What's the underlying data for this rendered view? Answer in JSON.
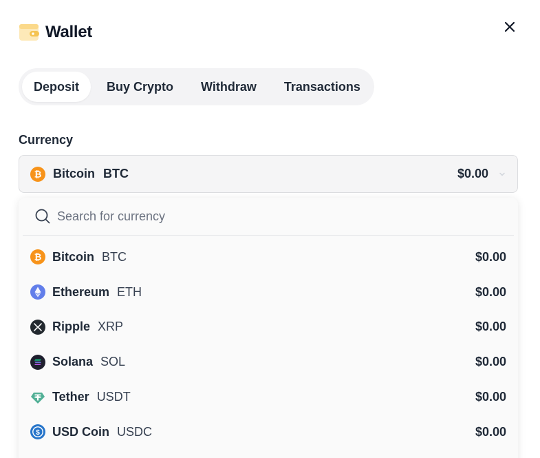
{
  "header": {
    "title": "Wallet",
    "icon": "wallet-icon",
    "close_icon": "close-icon"
  },
  "tabs": [
    {
      "label": "Deposit",
      "active": true
    },
    {
      "label": "Buy Crypto",
      "active": false
    },
    {
      "label": "Withdraw",
      "active": false
    },
    {
      "label": "Transactions",
      "active": false
    }
  ],
  "currency": {
    "label": "Currency",
    "selected": {
      "name": "Bitcoin",
      "symbol": "BTC",
      "amount": "$0.00",
      "icon": "bitcoin-icon"
    }
  },
  "search": {
    "placeholder": "Search for currency",
    "value": ""
  },
  "currencies": [
    {
      "name": "Bitcoin",
      "symbol": "BTC",
      "amount": "$0.00",
      "icon": "bitcoin-icon",
      "color": "#f7931a"
    },
    {
      "name": "Ethereum",
      "symbol": "ETH",
      "amount": "$0.00",
      "icon": "ethereum-icon",
      "color": "#627eea"
    },
    {
      "name": "Ripple",
      "symbol": "XRP",
      "amount": "$0.00",
      "icon": "ripple-icon",
      "color": "#23292f"
    },
    {
      "name": "Solana",
      "symbol": "SOL",
      "amount": "$0.00",
      "icon": "solana-icon",
      "color": "#1f1f2e"
    },
    {
      "name": "Tether",
      "symbol": "USDT",
      "amount": "$0.00",
      "icon": "tether-icon",
      "color": "#50af95"
    },
    {
      "name": "USD Coin",
      "symbol": "USDC",
      "amount": "$0.00",
      "icon": "usd-coin-icon",
      "color": "#2775ca"
    }
  ],
  "colors": {
    "wallet_icon": "#f5c451",
    "tab_bg": "#f3f3f5",
    "select_bg": "#f5f5f6"
  }
}
